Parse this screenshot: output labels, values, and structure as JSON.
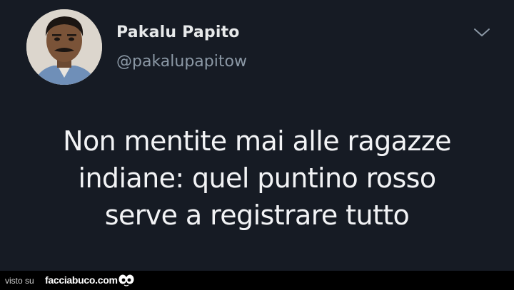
{
  "tweet": {
    "display_name": "Pakalu Papito",
    "handle": "@pakalupapitow",
    "text_lines": [
      "Non mentite mai alle ragazze",
      "indiane: quel puntino rosso",
      "serve a registrare tutto"
    ],
    "menu_icon": "chevron-down-icon",
    "avatar": "profile-photo"
  },
  "footer": {
    "prefix": "visto su",
    "site": "facciabuco.com",
    "logo_icon": "eyes-icon"
  },
  "colors": {
    "background": "#161b24",
    "text_primary": "#e7e9ea",
    "text_secondary": "#8b98a5",
    "footer_background": "#000000"
  }
}
